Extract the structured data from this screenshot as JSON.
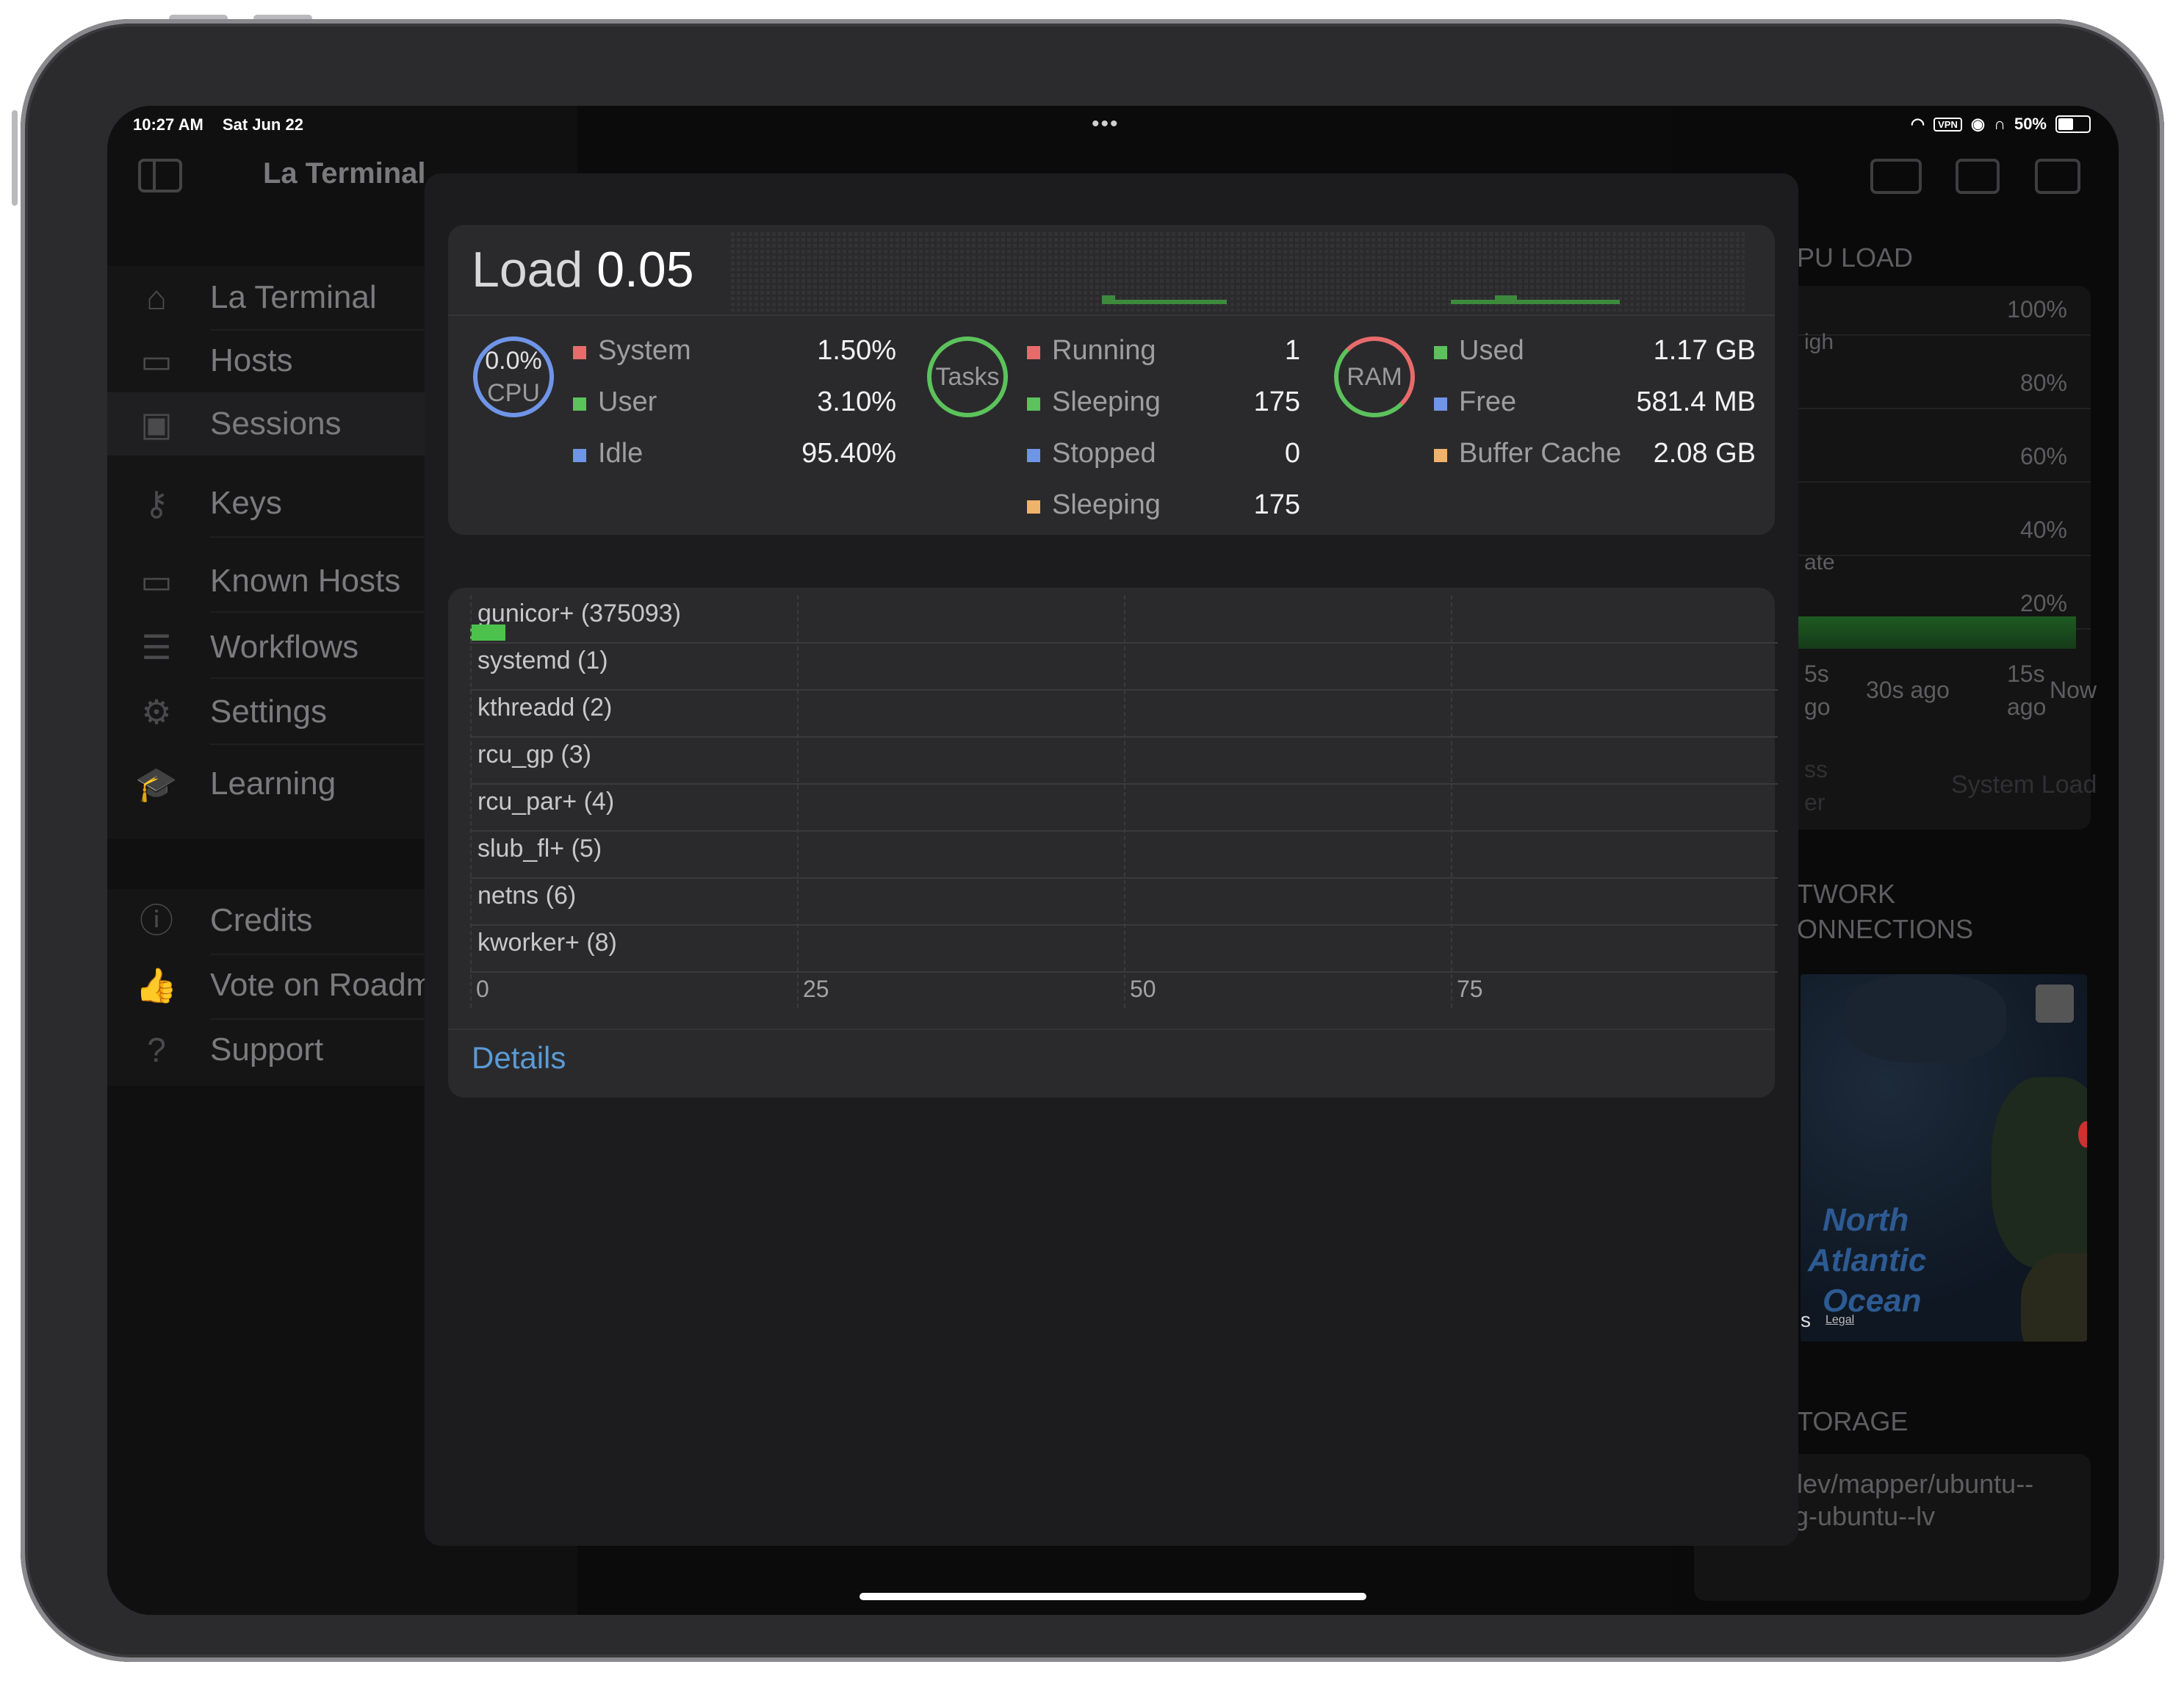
{
  "status_bar": {
    "time": "10:27 AM",
    "date": "Sat Jun 22",
    "vpn": "VPN",
    "battery": "50%",
    "battery_level": 0.5
  },
  "sidebar": {
    "title": "La Terminal",
    "items": [
      {
        "label": "La Terminal",
        "icon": "house-icon"
      },
      {
        "label": "Hosts",
        "icon": "monitor-icon"
      },
      {
        "label": "Sessions",
        "icon": "terminal-icon"
      },
      {
        "label": "Keys",
        "icon": "key-icon"
      },
      {
        "label": "Known Hosts",
        "icon": "lock-monitor-icon"
      },
      {
        "label": "Workflows",
        "icon": "list-icon"
      },
      {
        "label": "Settings",
        "icon": "gear-icon"
      },
      {
        "label": "Learning",
        "icon": "graduation-cap-icon"
      }
    ],
    "footer_items": [
      {
        "label": "Credits",
        "icon": "info-icon"
      },
      {
        "label": "Vote on Roadm",
        "icon": "thumbs-up-icon"
      },
      {
        "label": "Support",
        "icon": "question-icon"
      }
    ]
  },
  "right_pane": {
    "cpu_load_title": "PU LOAD",
    "pct_labels": [
      "100%",
      "80%",
      "60%",
      "40%",
      "20%"
    ],
    "legend_high": "igh",
    "legend_rate": "ate",
    "time_labels": {
      "t1a": "5s",
      "t1b": "go",
      "t2": "30s ago",
      "t3a": "15s",
      "t3b": "ago",
      "t4": "Now"
    },
    "foot_left_a": "ss",
    "foot_left_b": "er",
    "foot_right": "System Load",
    "network_a": "TWORK",
    "network_b": "ONNECTIONS",
    "map_labels": {
      "north": "North",
      "atlantic": "Atlantic",
      "ocean": "Ocean",
      "legal": "Legal",
      "s": "s"
    },
    "storage_title": "TORAGE",
    "storage_path_a": "lev/mapper/ubuntu--",
    "storage_path_b": "vg-ubuntu--lv"
  },
  "modal": {
    "load_label": "Load",
    "load_value": "0.05",
    "cpu": {
      "ring_value": "0.0%",
      "ring_label": "CPU",
      "rows": [
        {
          "label": "System",
          "value": "1.50%",
          "color": "#e86b6b"
        },
        {
          "label": "User",
          "value": "3.10%",
          "color": "#5cc25c"
        },
        {
          "label": "Idle",
          "value": "95.40%",
          "color": "#6f95e8"
        }
      ]
    },
    "tasks": {
      "ring_label": "Tasks",
      "rows": [
        {
          "label": "Running",
          "value": "1",
          "color": "#e86b6b"
        },
        {
          "label": "Sleeping",
          "value": "175",
          "color": "#5cc25c"
        },
        {
          "label": "Stopped",
          "value": "0",
          "color": "#6f95e8"
        },
        {
          "label": "Sleeping",
          "value": "175",
          "color": "#f0b36a"
        }
      ]
    },
    "ram": {
      "ring_label": "RAM",
      "rows": [
        {
          "label": "Used",
          "value": "1.17 GB",
          "color": "#5cc25c"
        },
        {
          "label": "Free",
          "value": "581.4 MB",
          "color": "#6f95e8"
        },
        {
          "label": "Buffer Cache",
          "value": "2.08 GB",
          "color": "#f0b36a"
        }
      ]
    },
    "processes": [
      {
        "name": "gunicor+ (375093)",
        "value": 2.7
      },
      {
        "name": "systemd (1)",
        "value": 0
      },
      {
        "name": "kthreadd (2)",
        "value": 0
      },
      {
        "name": "rcu_gp (3)",
        "value": 0
      },
      {
        "name": "rcu_par+ (4)",
        "value": 0
      },
      {
        "name": "slub_fl+ (5)",
        "value": 0
      },
      {
        "name": "netns (6)",
        "value": 0
      },
      {
        "name": "kworker+ (8)",
        "value": 0
      }
    ],
    "axis_ticks": [
      "0",
      "25",
      "50",
      "75"
    ],
    "axis_max": 100,
    "bar_color": "#4cc24c",
    "details_label": "Details"
  }
}
